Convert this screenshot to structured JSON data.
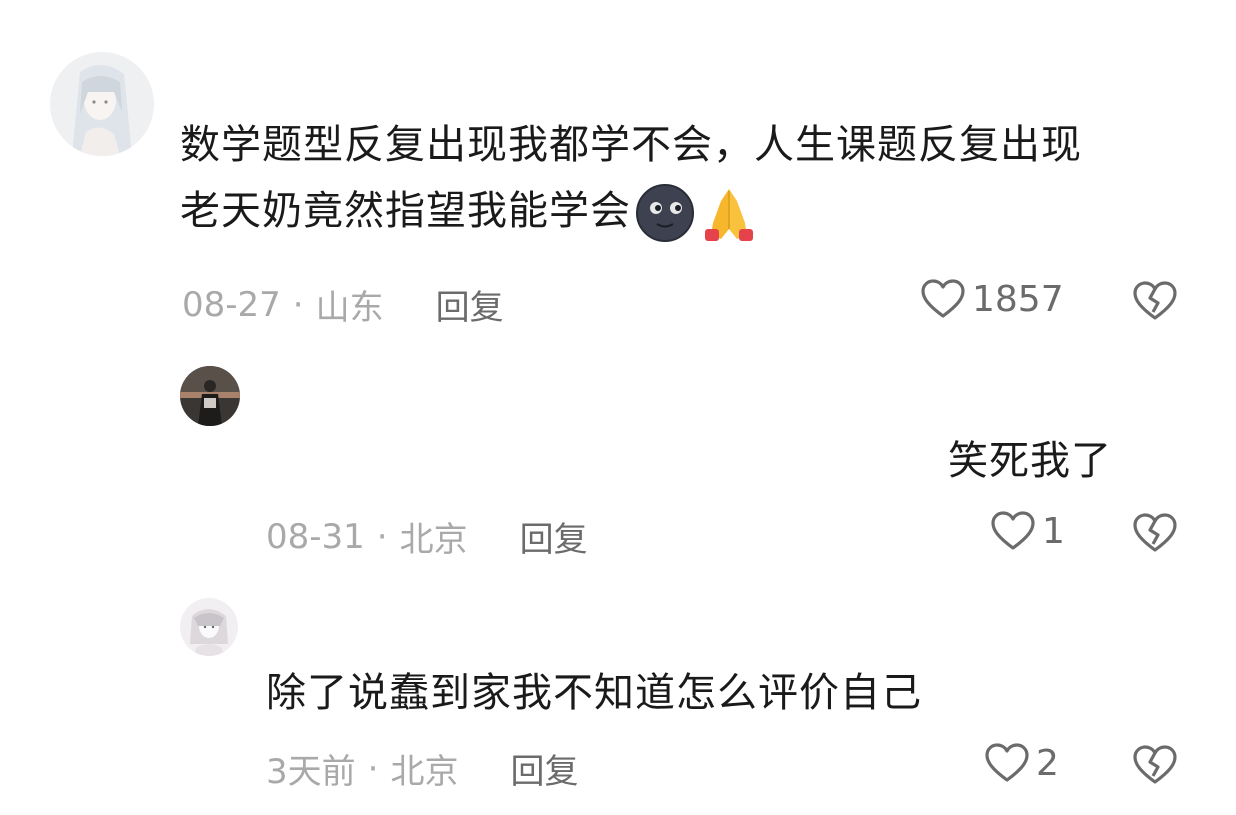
{
  "comments": [
    {
      "text_line1": "数学题型反复出现我都学不会，人生课题反复出现",
      "text_line2": "老天奶竟然指望我能学会",
      "emoji_1": "new-moon-face-icon",
      "emoji_2": "folded-hands-icon",
      "date": "08-27",
      "location": "山东",
      "reply_label": "回复",
      "likes": "1857"
    },
    {
      "text": "笑死我了",
      "date": "08-31",
      "location": "北京",
      "reply_label": "回复",
      "likes": "1"
    },
    {
      "text": "除了说蠢到家我不知道怎么评价自己",
      "date": "3天前",
      "location": "北京",
      "reply_label": "回复",
      "likes": "2"
    }
  ],
  "separator": "·",
  "icons": {
    "like": "heart-outline-icon",
    "dislike": "broken-heart-icon"
  },
  "colors": {
    "text": "#1a1a1a",
    "meta": "#a9a9a9",
    "icon": "#6b6b6b"
  }
}
